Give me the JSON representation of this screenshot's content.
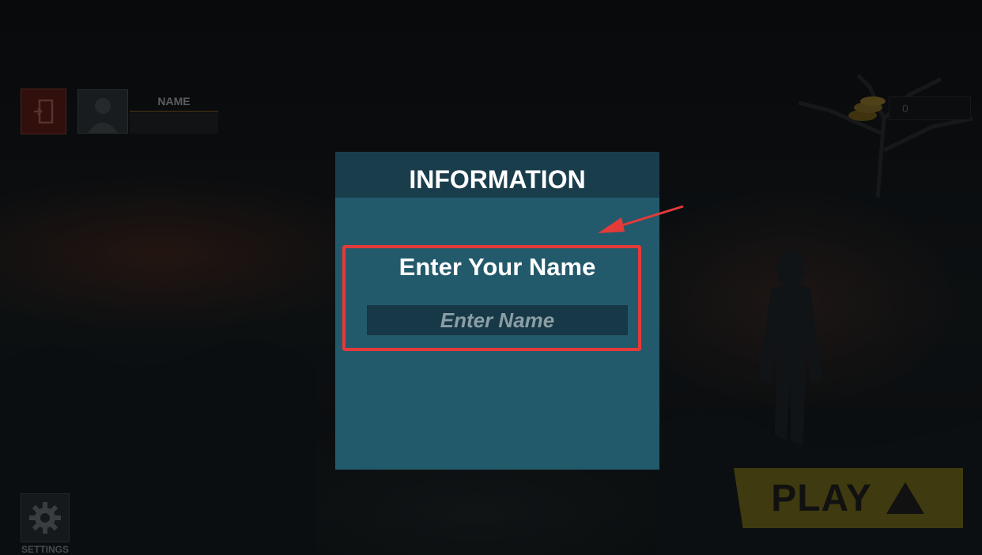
{
  "hud": {
    "name_label": "NAME",
    "coin_count": "0"
  },
  "settings": {
    "label": "SETTINGS"
  },
  "play": {
    "label": "PLAY"
  },
  "dialog": {
    "title": "INFORMATION",
    "prompt": "Enter Your Name",
    "input_value": "",
    "input_placeholder": "Enter Name"
  },
  "annotation": {
    "color": "#e53a3a"
  },
  "icons": [
    "exit-door-icon",
    "avatar-icon",
    "coin-stack-icon",
    "gear-icon",
    "play-triangle-icon",
    "annotation-arrow-icon"
  ]
}
